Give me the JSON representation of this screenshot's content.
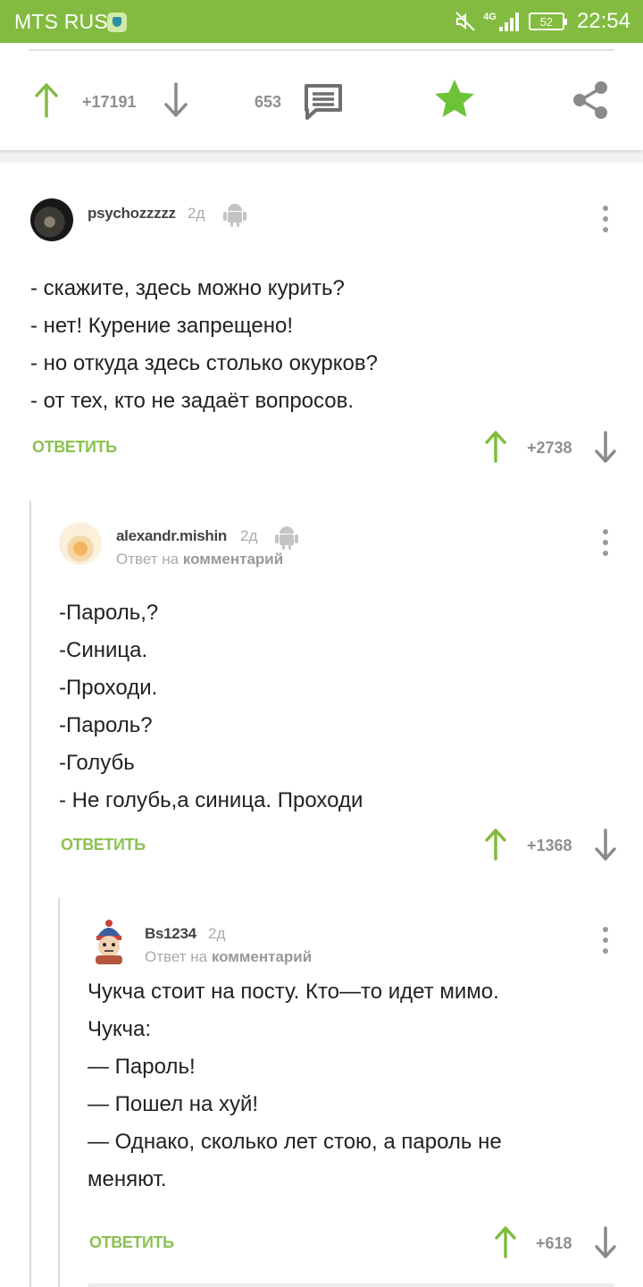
{
  "status_bar": {
    "carrier": "MTS RUS",
    "network": "4G",
    "battery": "52",
    "time": "22:54"
  },
  "post_bar": {
    "rating": "+17191",
    "comments_count": "653"
  },
  "colors": {
    "accent_green": "#82bb3f",
    "link_green": "#8cc152",
    "muted_gray": "#8f8f8f"
  },
  "comments": [
    {
      "author": "psychozzzzz",
      "age": "2д",
      "body": "- скажите, здесь можно курить?\n- нет! Курение запрещено!\n- но откуда здесь столько окурков?\n- от тех, кто не задаёт вопросов.",
      "reply_label": "ОТВЕТИТЬ",
      "rating": "+2738"
    },
    {
      "author": "alexandr.mishin",
      "age": "2д",
      "reply_prefix": "Ответ на",
      "reply_target": "комментарий",
      "body": "-Пароль,?\n-Синица.\n-Проходи.\n-Пароль?\n-Голубь\n- Не голубь,а синица. Проходи",
      "reply_label": "ОТВЕТИТЬ",
      "rating": "+1368"
    },
    {
      "author": "Bs1234",
      "age": "2д",
      "reply_prefix": "Ответ на",
      "reply_target": "комментарий",
      "body": "Чукча стоит на посту. Кто—то идет мимо.\nЧукча:\n — Пароль!\n — Пошел на хуй!\n — Однако, сколько лет стою, а пароль не\nменяют.",
      "reply_label": "ОТВЕТИТЬ",
      "rating": "+618"
    }
  ]
}
